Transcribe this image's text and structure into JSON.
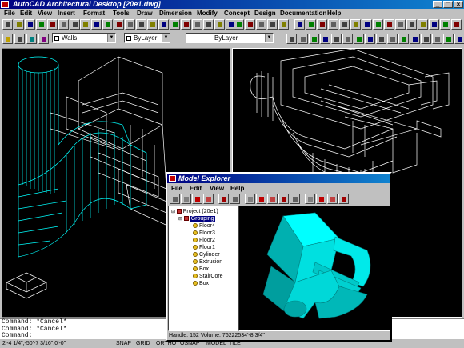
{
  "app": {
    "title": "AutoCAD Architectural Desktop   [20e1.dwg]",
    "caption_buttons": [
      "_",
      "□",
      "×"
    ]
  },
  "menubar": {
    "items": [
      "File",
      "Edit",
      "View",
      "Insert",
      "Format",
      "Tools",
      "Draw",
      "Dimension",
      "Modify",
      "Concept",
      "Design",
      "Documentation",
      "Help"
    ]
  },
  "properties_bar": {
    "layer_value": "Walls",
    "color_value": "ByLayer",
    "linetype_value": "ByLayer",
    "accent": "#00ffff"
  },
  "viewports": {
    "left_view": "3D wireframe (cyan cylinder and stair tower)",
    "right_view": "3D wireframe (white)"
  },
  "command_line": {
    "lines": [
      "Command:  *Cancel*",
      "Command:  *Cancel*",
      "Command:"
    ]
  },
  "status_bar": {
    "coords": "2'-4 1/4\",-50'-7 3/16\",0'-0\"",
    "toggles": [
      "SNAP",
      "GRID",
      "ORTHO",
      "OSNAP",
      "MODEL",
      "TILE"
    ]
  },
  "explorer": {
    "title": "Model Explorer",
    "menu": [
      "File",
      "Edit",
      "View",
      "Help"
    ],
    "tree": {
      "root": "Project (20e1)",
      "group": "Grouping",
      "children": [
        "Floor4",
        "Floor3",
        "Floor2",
        "Floor1",
        "Cylinder",
        "Extrusion",
        "Box",
        "StairCore",
        "Box"
      ]
    },
    "status": "Handle: 152  Volume: 76222534'-8 3/4\"",
    "model_color": "#00e5e5"
  },
  "colors": {
    "titlebar": "#000080",
    "wire_cyan": "#00ffff",
    "wire_white": "#ffffff",
    "viewport_bg": "#000000"
  }
}
